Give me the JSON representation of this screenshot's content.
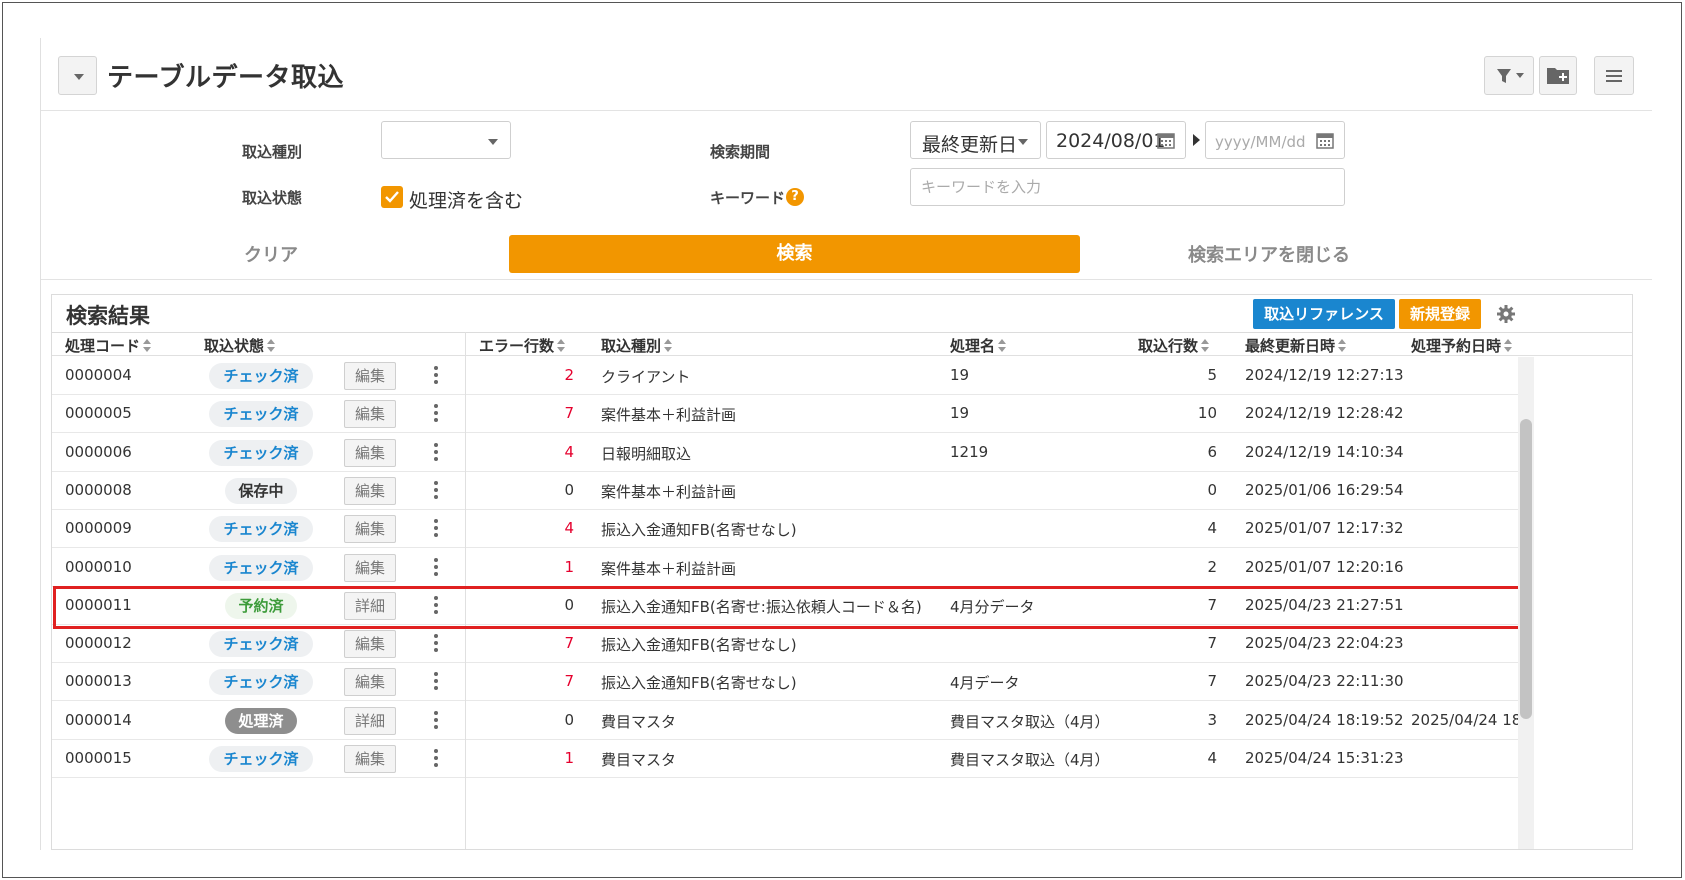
{
  "header": {
    "title": "テーブルデータ取込"
  },
  "search": {
    "import_type_label": "取込種別",
    "import_type_value": "",
    "status_label": "取込状態",
    "include_processed_label": "処理済を含む",
    "include_processed_checked": true,
    "period_label": "検索期間",
    "period_field": "最終更新日",
    "date_from": "2024/08/01",
    "date_to_placeholder": "yyyy/MM/dd",
    "keyword_label": "キーワード",
    "keyword_help": "?",
    "keyword_placeholder": "キーワードを入力"
  },
  "actions": {
    "clear": "クリア",
    "search": "検索",
    "close_search": "検索エリアを閉じる"
  },
  "results": {
    "title": "検索結果",
    "reference_button": "取込リファレンス",
    "new_button": "新規登録",
    "columns": {
      "code": "処理コード",
      "status": "取込状態",
      "errors": "エラー行数",
      "type": "取込種別",
      "name": "処理名",
      "rows": "取込行数",
      "updated": "最終更新日時",
      "scheduled": "処理予約日時"
    },
    "rows": [
      {
        "code": "0000004",
        "status": "チェック済",
        "kind": "check",
        "action": "編集",
        "errors": "2",
        "err_red": true,
        "type": "クライアント",
        "name": "19",
        "count": "5",
        "updated": "2024/12/19 12:27:13",
        "scheduled": ""
      },
      {
        "code": "0000005",
        "status": "チェック済",
        "kind": "check",
        "action": "編集",
        "errors": "7",
        "err_red": true,
        "type": "案件基本＋利益計画",
        "name": "19",
        "count": "10",
        "updated": "2024/12/19 12:28:42",
        "scheduled": ""
      },
      {
        "code": "0000006",
        "status": "チェック済",
        "kind": "check",
        "action": "編集",
        "errors": "4",
        "err_red": true,
        "type": "日報明細取込",
        "name": "1219",
        "count": "6",
        "updated": "2024/12/19 14:10:34",
        "scheduled": ""
      },
      {
        "code": "0000008",
        "status": "保存中",
        "kind": "save",
        "action": "編集",
        "errors": "0",
        "err_red": false,
        "type": "案件基本＋利益計画",
        "name": "",
        "count": "0",
        "updated": "2025/01/06 16:29:54",
        "scheduled": ""
      },
      {
        "code": "0000009",
        "status": "チェック済",
        "kind": "check",
        "action": "編集",
        "errors": "4",
        "err_red": true,
        "type": "振込入金通知FB(名寄せなし)",
        "name": "",
        "count": "4",
        "updated": "2025/01/07 12:17:32",
        "scheduled": ""
      },
      {
        "code": "0000010",
        "status": "チェック済",
        "kind": "check",
        "action": "編集",
        "errors": "1",
        "err_red": true,
        "type": "案件基本＋利益計画",
        "name": "",
        "count": "2",
        "updated": "2025/01/07 12:20:16",
        "scheduled": ""
      },
      {
        "code": "0000011",
        "status": "予約済",
        "kind": "reserved",
        "action": "詳細",
        "errors": "0",
        "err_red": false,
        "type": "振込入金通知FB(名寄せ:振込依頼人コード＆名)",
        "name": "4月分データ",
        "count": "7",
        "updated": "2025/04/23 21:27:51",
        "scheduled": ""
      },
      {
        "code": "0000012",
        "status": "チェック済",
        "kind": "check",
        "action": "編集",
        "errors": "7",
        "err_red": true,
        "type": "振込入金通知FB(名寄せなし)",
        "name": "",
        "count": "7",
        "updated": "2025/04/23 22:04:23",
        "scheduled": ""
      },
      {
        "code": "0000013",
        "status": "チェック済",
        "kind": "check",
        "action": "編集",
        "errors": "7",
        "err_red": true,
        "type": "振込入金通知FB(名寄せなし)",
        "name": "4月データ",
        "count": "7",
        "updated": "2025/04/23 22:11:30",
        "scheduled": ""
      },
      {
        "code": "0000014",
        "status": "処理済",
        "kind": "done",
        "action": "詳細",
        "errors": "0",
        "err_red": false,
        "type": "費目マスタ",
        "name": "費目マスタ取込（4月）",
        "count": "3",
        "updated": "2025/04/24 18:19:52",
        "scheduled": "2025/04/24 18:"
      },
      {
        "code": "0000015",
        "status": "チェック済",
        "kind": "check",
        "action": "編集",
        "errors": "1",
        "err_red": true,
        "type": "費目マスタ",
        "name": "費目マスタ取込（4月）",
        "count": "4",
        "updated": "2025/04/24 15:31:23",
        "scheduled": ""
      }
    ]
  },
  "colors": {
    "accent": "#f29600",
    "link_blue": "#1a86cf",
    "error_red": "#e5002d",
    "highlight": "#e02020"
  }
}
